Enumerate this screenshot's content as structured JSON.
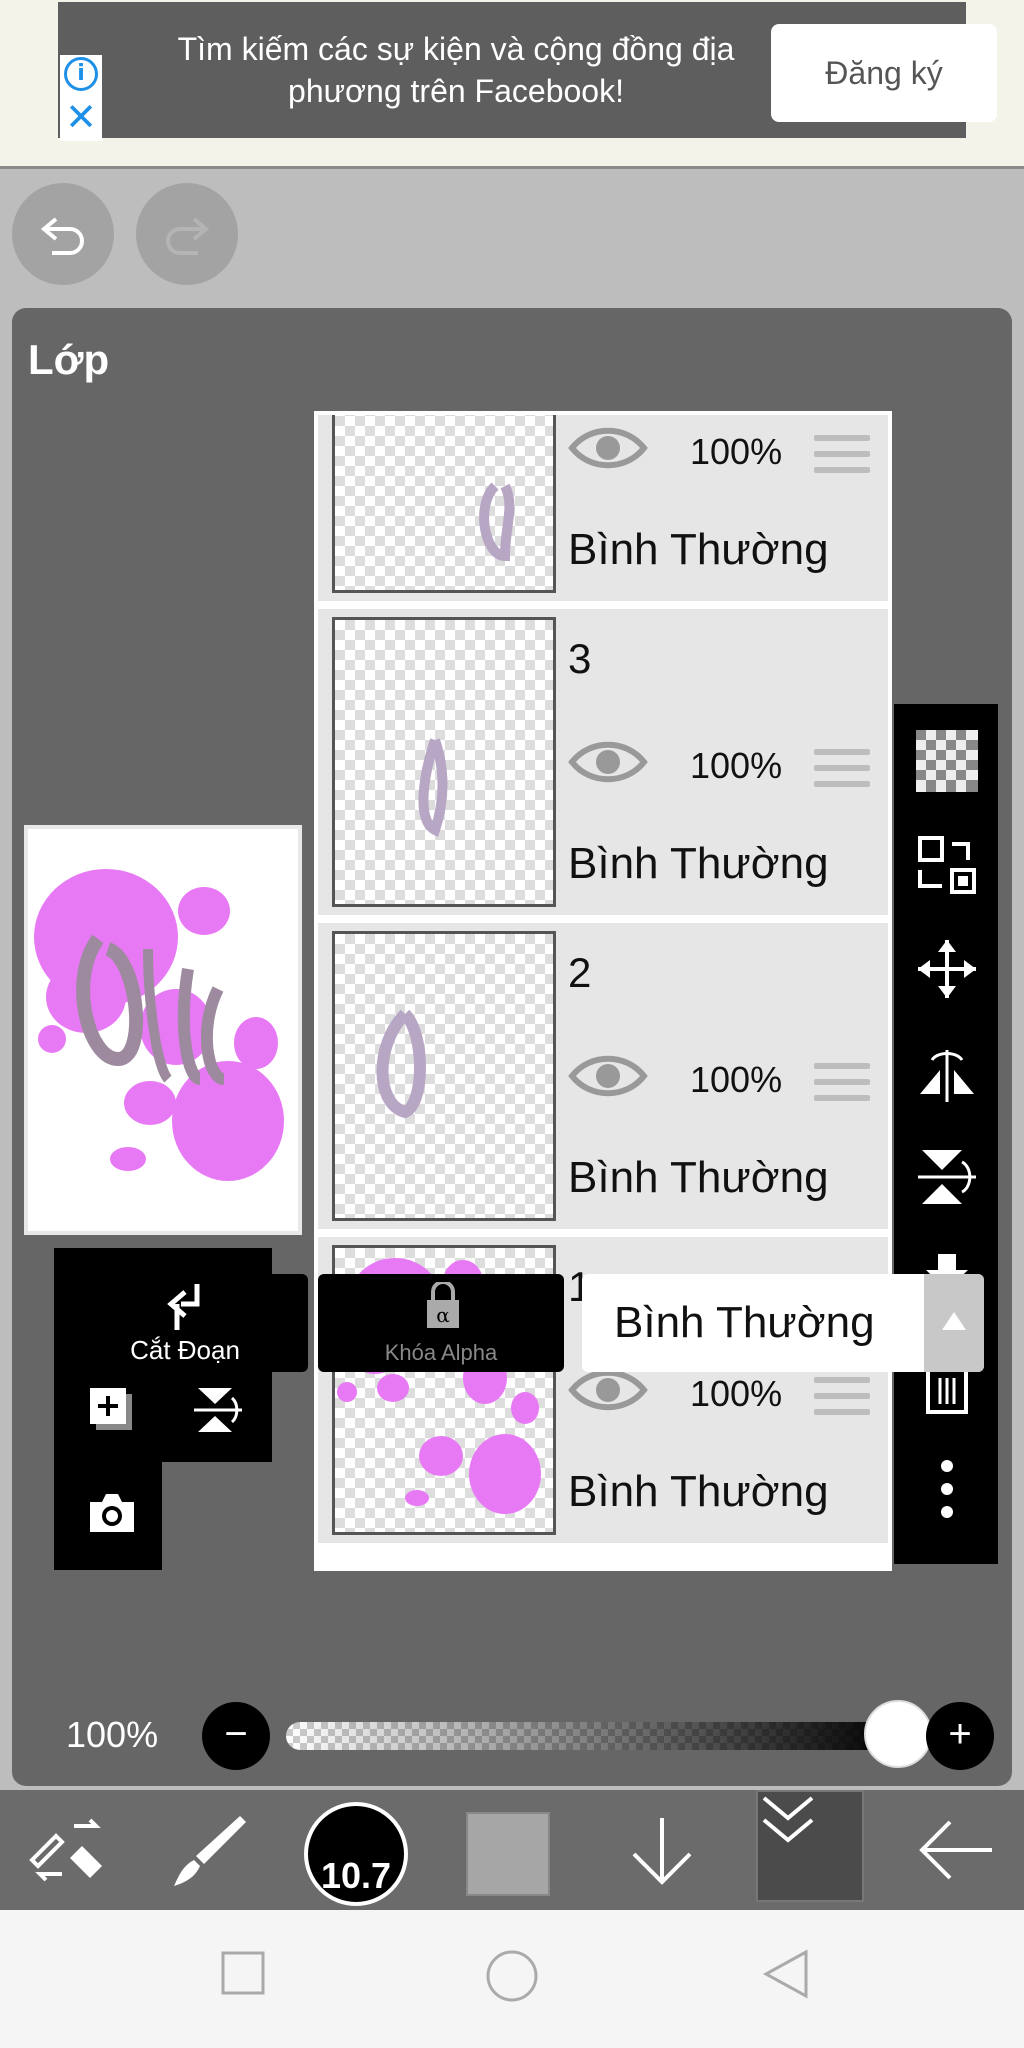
{
  "ad": {
    "message": "Tìm kiếm các sự kiện và cộng đồng địa phương trên Facebook!",
    "cta_label": "Đăng ký",
    "info_icon": "info-icon",
    "close_icon": "close-icon"
  },
  "history": {
    "undo_icon": "undo-icon",
    "redo_icon": "redo-icon"
  },
  "panel": {
    "title": "Lớp"
  },
  "layers": [
    {
      "number": "",
      "opacity": "100%",
      "mode": "Bình Thường"
    },
    {
      "number": "3",
      "opacity": "100%",
      "mode": "Bình Thường"
    },
    {
      "number": "2",
      "opacity": "100%",
      "mode": "Bình Thường"
    },
    {
      "number": "1",
      "opacity": "100%",
      "mode": "Bình Thường"
    }
  ],
  "buttons": {
    "clip_label": "Cắt Đoạn",
    "alpha_label": "Khóa Alpha",
    "blend_mode": "Bình Thường"
  },
  "opacity": {
    "label": "100%",
    "value": 1.0
  },
  "toolbar": {
    "brush_size": "10.7"
  },
  "colors": {
    "accent_pink": "#e879f5",
    "panel": "#666666",
    "ad_blue": "#1e90e8"
  }
}
